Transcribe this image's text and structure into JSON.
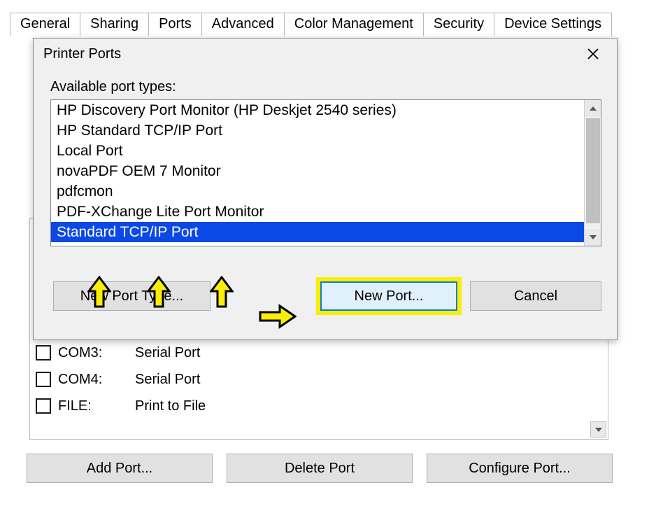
{
  "tabs": {
    "items": [
      "General",
      "Sharing",
      "Ports",
      "Advanced",
      "Color Management",
      "Security",
      "Device Settings"
    ],
    "active_index": 2
  },
  "dialog": {
    "title": "Printer Ports",
    "available_label": "Available port types:",
    "port_types": [
      "HP Discovery Port Monitor (HP Deskjet 2540 series)",
      "HP Standard TCP/IP Port",
      "Local Port",
      "novaPDF OEM 7 Monitor",
      "pdfcmon",
      "PDF-XChange Lite Port Monitor",
      "Standard TCP/IP Port"
    ],
    "selected_index": 6,
    "buttons": {
      "new_type": "New Port Type...",
      "new_port": "New Port...",
      "cancel": "Cancel"
    }
  },
  "background_ports": {
    "rows": [
      {
        "name": "COM3:",
        "desc": "Serial Port"
      },
      {
        "name": "COM4:",
        "desc": "Serial Port"
      },
      {
        "name": "FILE:",
        "desc": "Print to File"
      }
    ],
    "buttons": {
      "add": "Add Port...",
      "delete": "Delete Port",
      "configure": "Configure Port..."
    }
  },
  "annotation_color": "#f9ee04"
}
